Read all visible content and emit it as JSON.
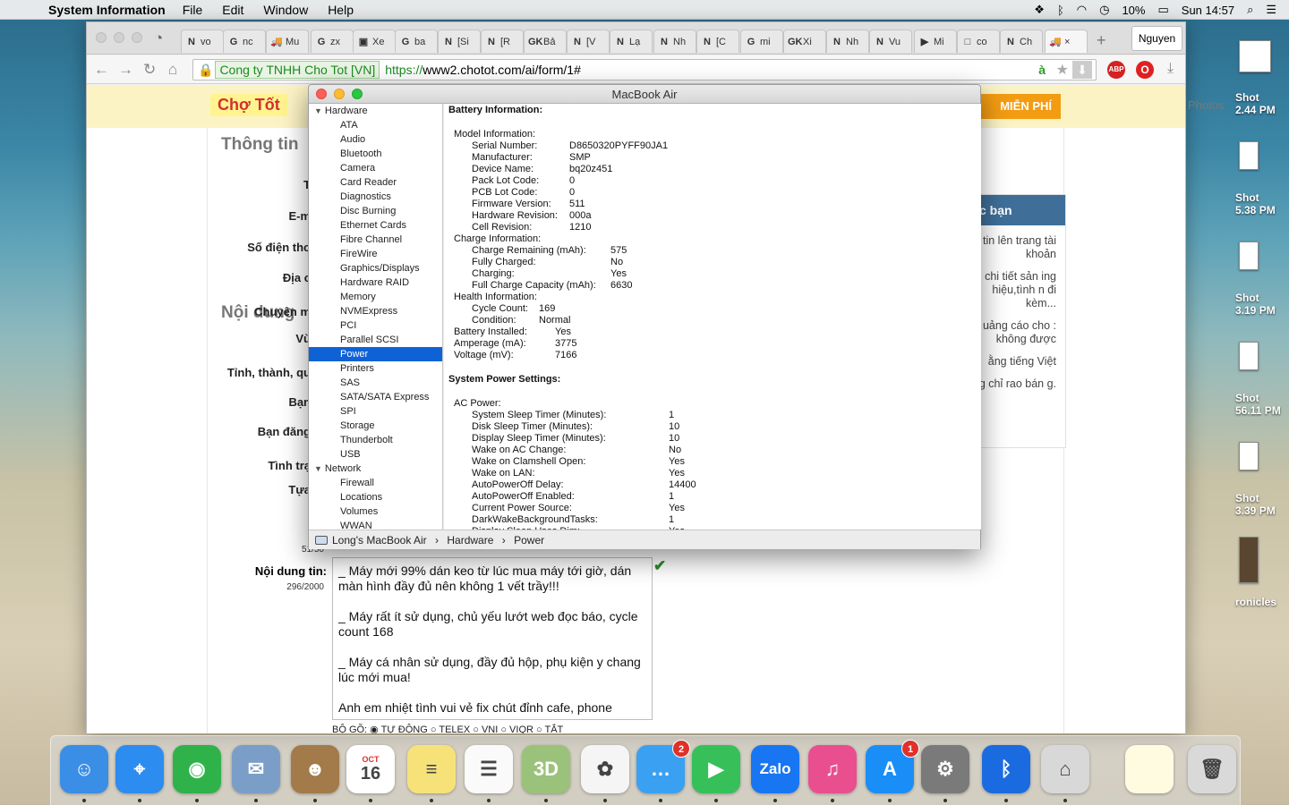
{
  "menubar": {
    "app_name": "System Information",
    "menus": [
      "File",
      "Edit",
      "Window",
      "Help"
    ],
    "battery": "10%",
    "clock": "Sun 14:57"
  },
  "desktop": {
    "screenshots": [
      {
        "label": "Shot",
        "time": "2.44 PM"
      },
      {
        "label": "Shot",
        "time": "5.38 PM"
      },
      {
        "label": "Shot",
        "time": "3.19 PM"
      },
      {
        "label": "Shot",
        "time": "56.11 PM"
      },
      {
        "label": "Shot",
        "time": "3.39 PM"
      }
    ],
    "photos_label": "Photos",
    "chronicles_label": "ronicles"
  },
  "browser": {
    "tabs": [
      {
        "icon": "N",
        "label": "vo"
      },
      {
        "icon": "G",
        "label": "nc"
      },
      {
        "icon": "🚚",
        "label": "Mu"
      },
      {
        "icon": "G",
        "label": "zx"
      },
      {
        "icon": "▣",
        "label": "Xe"
      },
      {
        "icon": "G",
        "label": "ba"
      },
      {
        "icon": "N",
        "label": "[Si"
      },
      {
        "icon": "N",
        "label": "[R"
      },
      {
        "icon": "GK",
        "label": "Bả"
      },
      {
        "icon": "N",
        "label": "[V"
      },
      {
        "icon": "N",
        "label": "Lạ"
      },
      {
        "icon": "N",
        "label": "Nh"
      },
      {
        "icon": "N",
        "label": "[C"
      },
      {
        "icon": "G",
        "label": "mi"
      },
      {
        "icon": "GK",
        "label": "Xi"
      },
      {
        "icon": "N",
        "label": "Nh"
      },
      {
        "icon": "N",
        "label": "Vu"
      },
      {
        "icon": "▶",
        "label": "Mi"
      },
      {
        "icon": "□",
        "label": "co"
      },
      {
        "icon": "N",
        "label": "Ch"
      },
      {
        "icon": "🚚",
        "label": "×"
      }
    ],
    "profile": "Nguyen",
    "ev_badge": "Cong ty TNHH Cho Tot [VN]",
    "url_scheme": "https://",
    "url_rest": "www2.chotot.com/ai/form/1#",
    "ext_abp": "ABP",
    "ext_abp_count": "2",
    "ext_opera_count": "2"
  },
  "page": {
    "logo": "Chợ Tốt",
    "post_free": "MIỄN PHÍ",
    "section1": "Thông tin",
    "section2": "Nội dung",
    "labels": [
      "T",
      "E-m",
      "Số điện tho",
      "Địa c",
      "Chuyên m",
      "Vù",
      "Tỉnh, thành, qu",
      "Bạn",
      "Bạn đăng",
      "Tình trạ",
      "Tựa"
    ],
    "title_count": "51/50",
    "desc_label": "Nội dung tin:",
    "desc_count": "296/2000",
    "desc_text": "_ Máy mới 99% dán keo từ lúc mua máy tới giờ, dán màn hình đầy đủ nên không 1 vết trầy!!!\n\n_ Máy rất ít sử dụng, chủ yếu lướt web đọc báo, cycle count 168\n\n_ Máy cá nhân sử dụng, đầy đủ hộp, phụ kiện y chang lúc mới mua!\n\nAnh em nhiệt tình vui vẻ fix chút đỉnh cafe, phone",
    "radios": "BỘ GÕ:  ◉ TỰ ĐỘNG   ○ TELEX   ○ VNI   ○ VIQR   ○ TẮT",
    "sidebox_title": "c bạn",
    "sidebox_lines": [
      "tin lên trang tài khoản",
      "chi tiết sản ing hiệu,tình n đi kèm...",
      "uảng cáo cho : không được",
      "ằng tiếng Việt",
      "ng chỉ rao bán g."
    ]
  },
  "sysinfo": {
    "title": "MacBook Air",
    "sidebar": [
      {
        "type": "cat",
        "label": "Hardware"
      },
      {
        "type": "item",
        "label": "ATA"
      },
      {
        "type": "item",
        "label": "Audio"
      },
      {
        "type": "item",
        "label": "Bluetooth"
      },
      {
        "type": "item",
        "label": "Camera"
      },
      {
        "type": "item",
        "label": "Card Reader"
      },
      {
        "type": "item",
        "label": "Diagnostics"
      },
      {
        "type": "item",
        "label": "Disc Burning"
      },
      {
        "type": "item",
        "label": "Ethernet Cards"
      },
      {
        "type": "item",
        "label": "Fibre Channel"
      },
      {
        "type": "item",
        "label": "FireWire"
      },
      {
        "type": "item",
        "label": "Graphics/Displays"
      },
      {
        "type": "item",
        "label": "Hardware RAID"
      },
      {
        "type": "item",
        "label": "Memory"
      },
      {
        "type": "item",
        "label": "NVMExpress"
      },
      {
        "type": "item",
        "label": "PCI"
      },
      {
        "type": "item",
        "label": "Parallel SCSI"
      },
      {
        "type": "item",
        "label": "Power",
        "selected": true
      },
      {
        "type": "item",
        "label": "Printers"
      },
      {
        "type": "item",
        "label": "SAS"
      },
      {
        "type": "item",
        "label": "SATA/SATA Express"
      },
      {
        "type": "item",
        "label": "SPI"
      },
      {
        "type": "item",
        "label": "Storage"
      },
      {
        "type": "item",
        "label": "Thunderbolt"
      },
      {
        "type": "item",
        "label": "USB"
      },
      {
        "type": "cat",
        "label": "Network"
      },
      {
        "type": "item",
        "label": "Firewall"
      },
      {
        "type": "item",
        "label": "Locations"
      },
      {
        "type": "item",
        "label": "Volumes"
      },
      {
        "type": "item",
        "label": "WWAN"
      }
    ],
    "battery_heading": "Battery Information:",
    "model_heading": "Model Information:",
    "model": [
      {
        "k": "Serial Number:",
        "v": "D8650320PYFF90JA1"
      },
      {
        "k": "Manufacturer:",
        "v": "SMP"
      },
      {
        "k": "Device Name:",
        "v": "bq20z451"
      },
      {
        "k": "Pack Lot Code:",
        "v": "0"
      },
      {
        "k": "PCB Lot Code:",
        "v": "0"
      },
      {
        "k": "Firmware Version:",
        "v": "511"
      },
      {
        "k": "Hardware Revision:",
        "v": "000a"
      },
      {
        "k": "Cell Revision:",
        "v": "1210"
      }
    ],
    "charge_heading": "Charge Information:",
    "charge": [
      {
        "k": "Charge Remaining (mAh):",
        "v": "575"
      },
      {
        "k": "Fully Charged:",
        "v": "No"
      },
      {
        "k": "Charging:",
        "v": "Yes"
      },
      {
        "k": "Full Charge Capacity (mAh):",
        "v": "6630"
      }
    ],
    "health_heading": "Health Information:",
    "health": [
      {
        "k": "Cycle Count:",
        "v": "169"
      },
      {
        "k": "Condition:",
        "v": "Normal"
      }
    ],
    "top": [
      {
        "k": "Battery Installed:",
        "v": "Yes"
      },
      {
        "k": "Amperage (mA):",
        "v": "3775"
      },
      {
        "k": "Voltage (mV):",
        "v": "7166"
      }
    ],
    "power_heading": "System Power Settings:",
    "ac_heading": "AC Power:",
    "ac": [
      {
        "k": "System Sleep Timer (Minutes):",
        "v": "1"
      },
      {
        "k": "Disk Sleep Timer (Minutes):",
        "v": "10"
      },
      {
        "k": "Display Sleep Timer (Minutes):",
        "v": "10"
      },
      {
        "k": "Wake on AC Change:",
        "v": "No"
      },
      {
        "k": "Wake on Clamshell Open:",
        "v": "Yes"
      },
      {
        "k": "Wake on LAN:",
        "v": "Yes"
      },
      {
        "k": "AutoPowerOff Delay:",
        "v": "14400"
      },
      {
        "k": "AutoPowerOff Enabled:",
        "v": "1"
      },
      {
        "k": "Current Power Source:",
        "v": "Yes"
      },
      {
        "k": "DarkWakeBackgroundTasks:",
        "v": "1"
      },
      {
        "k": "Display Sleep Uses Dim:",
        "v": "Yes"
      }
    ],
    "path": [
      "Long's MacBook Air",
      "Hardware",
      "Power"
    ]
  },
  "dock": [
    {
      "name": "finder",
      "label": "☺",
      "color": "#3a8ee6"
    },
    {
      "name": "safari",
      "label": "⌖",
      "color": "#2d8cf0"
    },
    {
      "name": "coccoc",
      "label": "◉",
      "color": "#2fb24a"
    },
    {
      "name": "preview",
      "label": "✉",
      "color": "#7a9ec7"
    },
    {
      "name": "contacts",
      "label": "☻",
      "color": "#a37a4a"
    },
    {
      "name": "calendar",
      "label": "16",
      "month": "OCT",
      "color": "#ffffff"
    },
    {
      "name": "notes",
      "label": "≡",
      "color": "#f7e27a"
    },
    {
      "name": "reminders",
      "label": "☰",
      "color": "#fafafa"
    },
    {
      "name": "maps",
      "label": "3D",
      "color": "#9bc27a"
    },
    {
      "name": "photos",
      "label": "✿",
      "color": "#f5f5f5"
    },
    {
      "name": "messages",
      "label": "…",
      "color": "#3aa1f2",
      "badge": "2"
    },
    {
      "name": "facetime",
      "label": "▶",
      "color": "#37c05a"
    },
    {
      "name": "zalo",
      "label": "Zalo",
      "color": "#1876f2"
    },
    {
      "name": "itunes",
      "label": "♫",
      "color": "#e94f8f"
    },
    {
      "name": "appstore",
      "label": "A",
      "color": "#1a8ef7",
      "badge": "1"
    },
    {
      "name": "system-preferences",
      "label": "⚙",
      "color": "#7a7a7a"
    },
    {
      "name": "bluetooth",
      "label": "ᛒ",
      "color": "#1a6be0"
    },
    {
      "name": "system-information",
      "label": "⌂",
      "color": "#d8d8d8"
    },
    {
      "name": "documents",
      "label": "",
      "color": "#fffbe0"
    },
    {
      "name": "trash",
      "label": "🗑",
      "color": "#d9d9d9"
    }
  ]
}
